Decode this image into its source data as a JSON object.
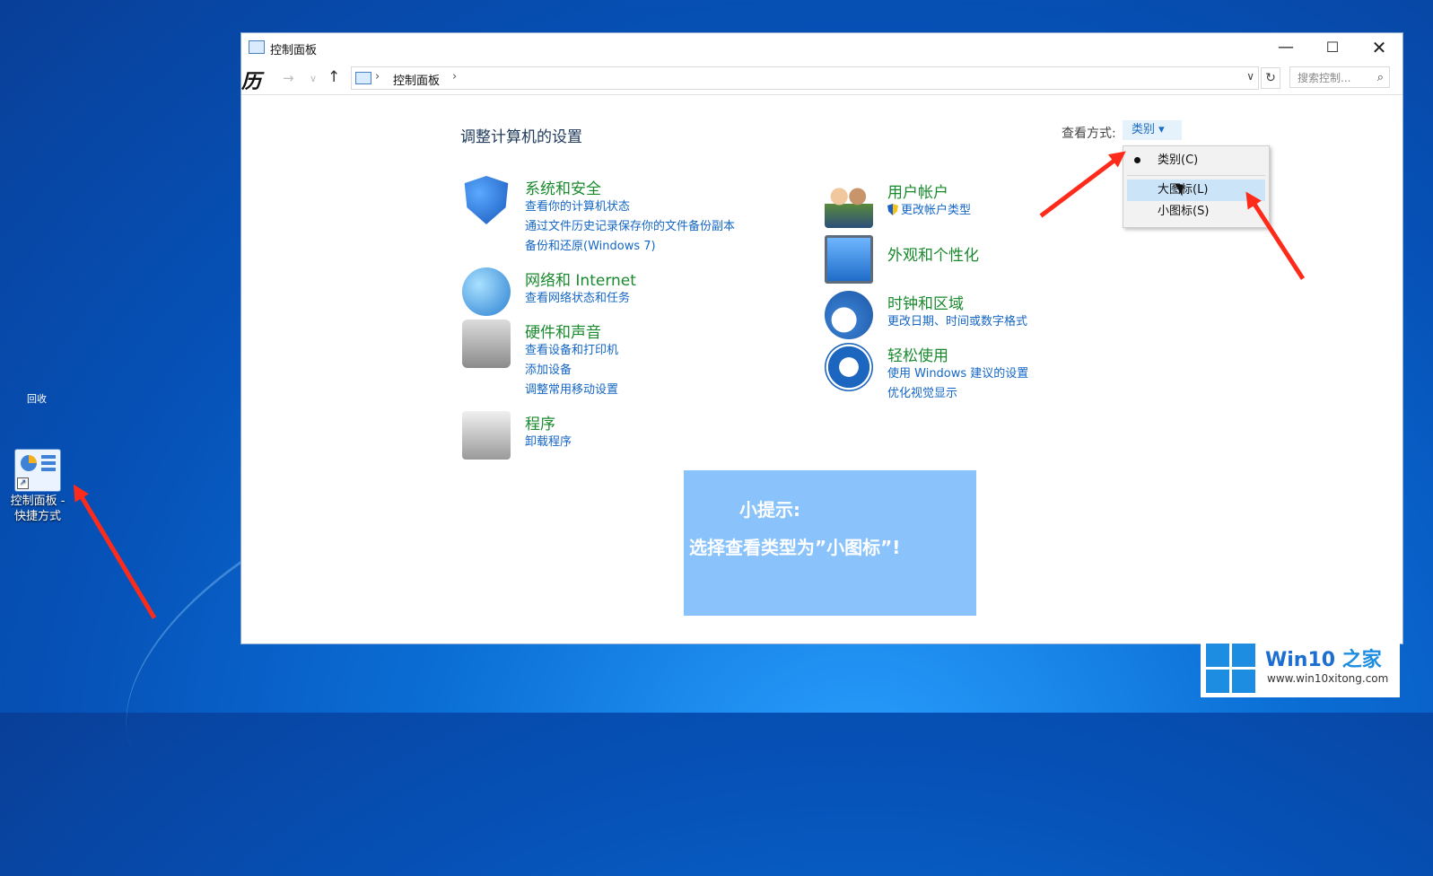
{
  "desktop": {
    "shortcut_label_line1": "控制面板 -",
    "shortcut_label_line2": "快捷方式",
    "partial_label": "回收"
  },
  "window": {
    "title": "控制面板",
    "min_glyph": "—",
    "max_glyph": "☐",
    "close_glyph": "✕"
  },
  "address": {
    "crumb": "控制面板",
    "separator": "›",
    "search_placeholder": "搜索控制...",
    "refresh_glyph": "↻",
    "dropdown_glyph": "∨"
  },
  "content": {
    "title": "调整计算机的设置",
    "viewby_label": "查看方式:",
    "viewby_value": "类别 ▾",
    "menu": {
      "items": [
        "类别(C)",
        "大图标(L)",
        "小图标(S)"
      ]
    }
  },
  "categories": {
    "system": {
      "title": "系统和安全",
      "links": [
        "查看你的计算机状态",
        "通过文件历史记录保存你的文件备份副本",
        "备份和还原(Windows 7)"
      ]
    },
    "network": {
      "title": "网络和 Internet",
      "links": [
        "查看网络状态和任务"
      ]
    },
    "hardware": {
      "title": "硬件和声音",
      "links": [
        "查看设备和打印机",
        "添加设备",
        "调整常用移动设置"
      ]
    },
    "programs": {
      "title": "程序",
      "links": [
        "卸载程序"
      ]
    },
    "users": {
      "title": "用户帐户",
      "links": [
        "更改帐户类型"
      ]
    },
    "appearance": {
      "title": "外观和个性化",
      "links": []
    },
    "clock": {
      "title": "时钟和区域",
      "links": [
        "更改日期、时间或数字格式"
      ]
    },
    "ease": {
      "title": "轻松使用",
      "links": [
        "使用 Windows 建议的设置",
        "优化视觉显示"
      ]
    }
  },
  "tip": {
    "line1": "小提示:",
    "line2": "选择查看类型为”小图标”!"
  },
  "watermark": {
    "brand_en": "Win10",
    "brand_zh": "之家",
    "url": "www.win10xitong.com"
  },
  "colors": {
    "accent_link": "#1466c4",
    "category_green": "#1a8a2e",
    "arrow_red": "#ff2b1a",
    "tip_blue": "#8ac3fb"
  }
}
